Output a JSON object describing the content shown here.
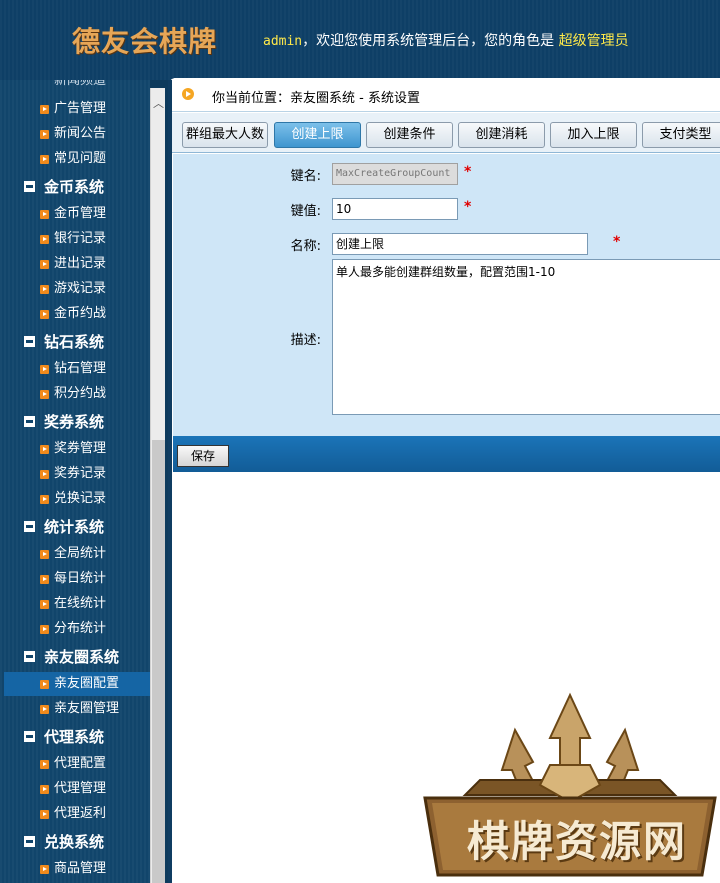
{
  "header": {
    "logo": "德友会棋牌",
    "user": "admin",
    "welcome_mid": "，欢迎您使用系统管理后台，您的角色是",
    "role": "超级管理员"
  },
  "sidebar": {
    "cut_item": "新闻频道",
    "items": [
      {
        "type": "item",
        "label": "广告管理"
      },
      {
        "type": "item",
        "label": "新闻公告"
      },
      {
        "type": "item",
        "label": "常见问题"
      },
      {
        "type": "group",
        "label": "金币系统"
      },
      {
        "type": "item",
        "label": "金币管理"
      },
      {
        "type": "item",
        "label": "银行记录"
      },
      {
        "type": "item",
        "label": "进出记录"
      },
      {
        "type": "item",
        "label": "游戏记录"
      },
      {
        "type": "item",
        "label": "金币约战"
      },
      {
        "type": "group",
        "label": "钻石系统"
      },
      {
        "type": "item",
        "label": "钻石管理"
      },
      {
        "type": "item",
        "label": "积分约战"
      },
      {
        "type": "group",
        "label": "奖券系统"
      },
      {
        "type": "item",
        "label": "奖券管理"
      },
      {
        "type": "item",
        "label": "奖券记录"
      },
      {
        "type": "item",
        "label": "兑换记录"
      },
      {
        "type": "group",
        "label": "统计系统"
      },
      {
        "type": "item",
        "label": "全局统计"
      },
      {
        "type": "item",
        "label": "每日统计"
      },
      {
        "type": "item",
        "label": "在线统计"
      },
      {
        "type": "item",
        "label": "分布统计"
      },
      {
        "type": "group",
        "label": "亲友圈系统"
      },
      {
        "type": "item",
        "label": "亲友圈配置",
        "active": true
      },
      {
        "type": "item",
        "label": "亲友圈管理"
      },
      {
        "type": "group",
        "label": "代理系统"
      },
      {
        "type": "item",
        "label": "代理配置"
      },
      {
        "type": "item",
        "label": "代理管理"
      },
      {
        "type": "item",
        "label": "代理返利"
      },
      {
        "type": "group",
        "label": "兑换系统"
      },
      {
        "type": "item",
        "label": "商品管理"
      }
    ]
  },
  "breadcrumb": "你当前位置：亲友圈系统 - 系统设置",
  "tabs": [
    {
      "label": "群组最大人数",
      "active": false
    },
    {
      "label": "创建上限",
      "active": true
    },
    {
      "label": "创建条件",
      "active": false
    },
    {
      "label": "创建消耗",
      "active": false
    },
    {
      "label": "加入上限",
      "active": false
    },
    {
      "label": "支付类型",
      "active": false
    }
  ],
  "form": {
    "key_label": "键名:",
    "key_value": "MaxCreateGroupCount",
    "value_label": "键值:",
    "value_value": "10",
    "name_label": "名称:",
    "name_value": "创建上限",
    "desc_label": "描述:",
    "desc_value": "单人最多能创建群组数量，配置范围1-10",
    "required_mark": "*"
  },
  "save_label": "保存",
  "watermark": "棋牌资源网",
  "colors": {
    "accent": "#1565a4",
    "sidebar_bg": "#11456b",
    "form_bg": "#cfe6f7",
    "required": "#e00000",
    "logo": "#e6a657"
  }
}
